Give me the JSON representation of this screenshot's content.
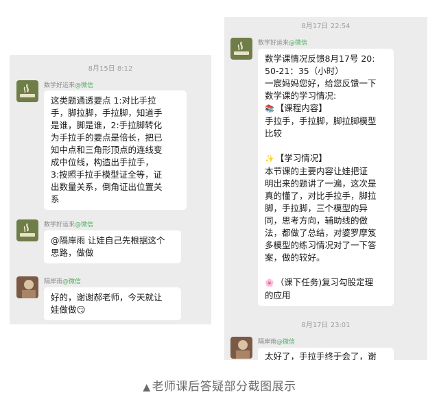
{
  "left_panel": {
    "timestamp": "8月15日 8:12",
    "messages": [
      {
        "sender": "数学好运来",
        "source": "@微信",
        "lines": [
          "这类题通透要点 1:对比手拉",
          "手，脚拉脚，手拉脚，知道手",
          "是谁，脚是谁，2:手拉脚转化",
          "为手拉手的要点是倍长，把已",
          "知中点和三角形顶点的连线变",
          "成中位线，构造出手拉手，",
          "3:按照手拉手模型证全等，证",
          "出数量关系，倒角证出位置关",
          "系"
        ]
      },
      {
        "sender": "数学好运来",
        "source": "@微信",
        "lines": [
          "@隔岸雨 让娃自己先根据这个",
          "思路，做做"
        ]
      },
      {
        "sender": "隔岸雨",
        "source": "@微信",
        "lines": [
          "好的，谢谢郝老师，今天就让",
          "娃做做"
        ],
        "emoji": "😏"
      }
    ]
  },
  "right_panel": {
    "timestamp_1": "8月17日 22:54",
    "timestamp_2": "8月17日 23:01",
    "report": {
      "sender": "数学好运来",
      "source": "@微信",
      "lines": [
        "数学课情况反馈8月17号 20:",
        "50-21：35（小时）",
        "一宸妈妈您好，给您反馈一下",
        "数学课的学习情况:",
        "【课程内容】",
        "手拉手，手拉脚，脚拉脚模型",
        "比较",
        "",
        "【学习情况】",
        "  本节课的主要内容让娃把证",
        "明出来的题讲了一遍，这次是",
        "真的懂了，对比手拉手，脚拉",
        "脚，手拉脚，三个模型的异",
        "同，思考方向，辅助线的做",
        "法，都做了总结，对婆罗摩笈",
        "多模型的练习情况对了一下答",
        "案，做的较好。",
        "",
        "（课下任务)复习勾股定理",
        "的应用"
      ],
      "icons": [
        "book-emoji",
        "sparkle-emoji",
        "flower-emoji"
      ]
    },
    "reply": {
      "sender": "隔岸雨",
      "source": "@微信",
      "text": "太好了，手拉手终于会了，谢"
    }
  },
  "caption": {
    "triangle": "▲",
    "text": "老师课后答疑部分截图展示"
  }
}
